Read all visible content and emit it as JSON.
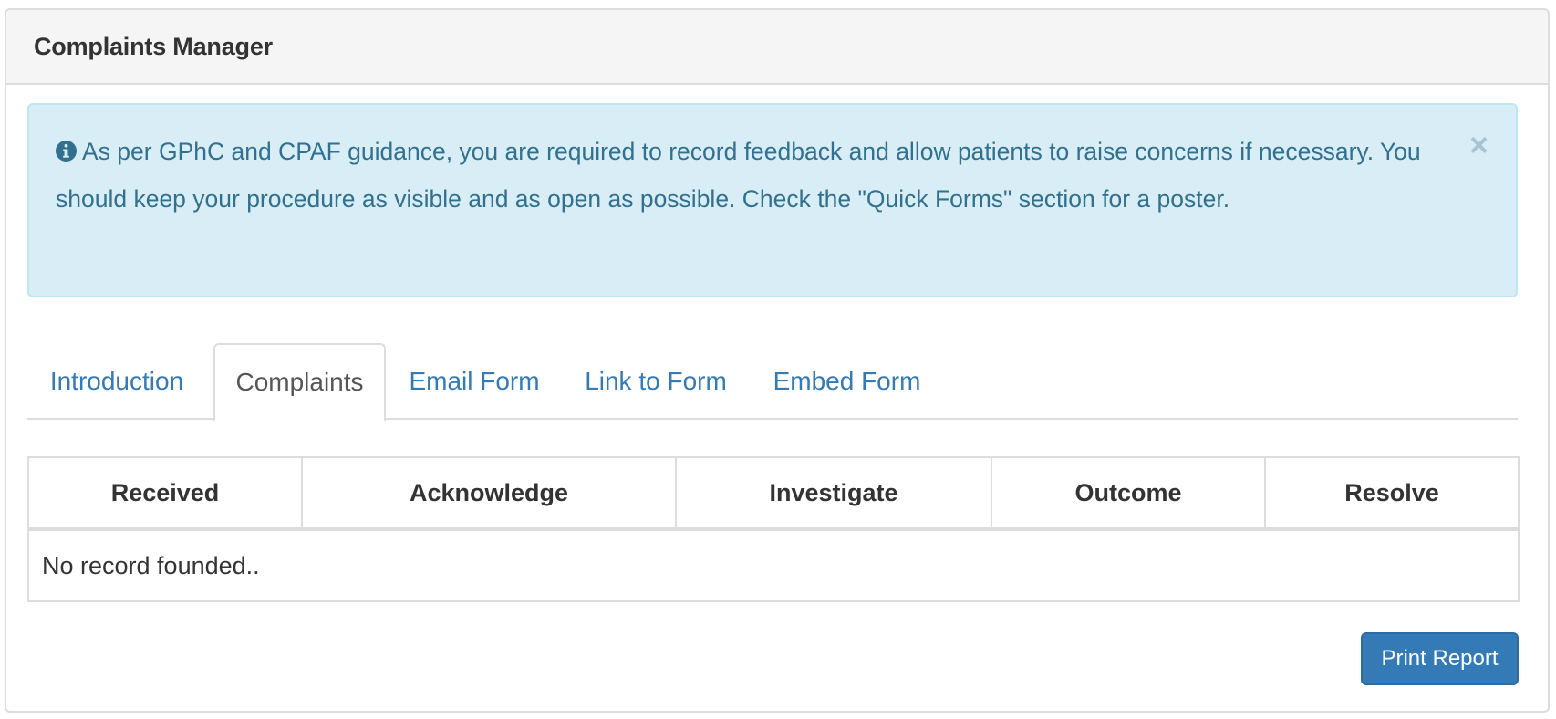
{
  "panel": {
    "title": "Complaints Manager"
  },
  "alert": {
    "icon": "info-circle-icon",
    "message": "As per GPhC and CPAF guidance, you are required to record feedback and allow patients to raise concerns if necessary. You should keep your procedure as visible and as open as possible. Check the \"Quick Forms\" section for a poster.",
    "close_label": "×",
    "colors": {
      "background": "#d9edf7",
      "text": "#31708f"
    }
  },
  "tabs": [
    {
      "label": "Introduction",
      "active": false
    },
    {
      "label": "Complaints",
      "active": true
    },
    {
      "label": "Email Form",
      "active": false
    },
    {
      "label": "Link to Form",
      "active": false
    },
    {
      "label": "Embed Form",
      "active": false
    }
  ],
  "table": {
    "headers": [
      "Received",
      "Acknowledge",
      "Investigate",
      "Outcome",
      "Resolve"
    ],
    "empty_message": "No record founded.."
  },
  "actions": {
    "print_label": "Print Report",
    "color": "#337ab7"
  }
}
